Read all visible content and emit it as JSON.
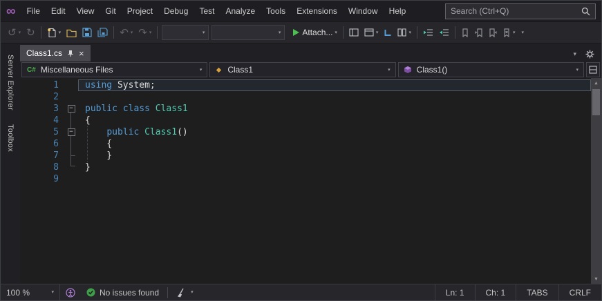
{
  "icons": {
    "logo": "∞",
    "back": "↺",
    "forward": "↻",
    "undo": "↶",
    "redo": "↷",
    "caret_down": "▾",
    "scroll_up": "▲",
    "scroll_down": "▼",
    "close": "×",
    "collapse": "−"
  },
  "menubar": {
    "menus": [
      "File",
      "Edit",
      "View",
      "Git",
      "Project",
      "Debug",
      "Test",
      "Analyze",
      "Tools",
      "Extensions",
      "Window",
      "Help"
    ],
    "search_placeholder": "Search (Ctrl+Q)"
  },
  "toolbar": {
    "attach_label": "Attach..."
  },
  "side_tabs": {
    "server_explorer": "Server Explorer",
    "toolbox": "Toolbox"
  },
  "doc": {
    "active_tab": "Class1.cs"
  },
  "navbar": {
    "project": "Miscellaneous Files",
    "type": "Class1",
    "member": "Class1()",
    "csharp_badge": "C#"
  },
  "editor": {
    "lines": [
      {
        "n": "1",
        "caret": true,
        "segs": [
          [
            "kw",
            "using"
          ],
          [
            "pl",
            " System;"
          ]
        ]
      },
      {
        "n": "2",
        "segs": []
      },
      {
        "n": "3",
        "fold": true,
        "segs": [
          [
            "kw",
            "public"
          ],
          [
            "pl",
            " "
          ],
          [
            "kw",
            "class"
          ],
          [
            "pl",
            " "
          ],
          [
            "ty",
            "Class1"
          ]
        ]
      },
      {
        "n": "4",
        "segs": [
          [
            "pl",
            "{"
          ]
        ]
      },
      {
        "n": "5",
        "fold": true,
        "segs": [
          [
            "pl",
            "    "
          ],
          [
            "kw",
            "public"
          ],
          [
            "pl",
            " "
          ],
          [
            "ty",
            "Class1"
          ],
          [
            "pl",
            "()"
          ]
        ]
      },
      {
        "n": "6",
        "segs": [
          [
            "pl",
            "    {"
          ]
        ]
      },
      {
        "n": "7",
        "segs": [
          [
            "pl",
            "    }"
          ]
        ]
      },
      {
        "n": "8",
        "segs": [
          [
            "pl",
            "}"
          ]
        ]
      },
      {
        "n": "9",
        "segs": []
      }
    ]
  },
  "statusbar": {
    "zoom": "100 %",
    "issues": "No issues found",
    "line": "Ln: 1",
    "column": "Ch: 1",
    "indent_mode": "TABS",
    "line_ending": "CRLF"
  },
  "colors": {
    "keyword": "#569cd6",
    "type_name": "#4ec9b0",
    "plain_text": "#dcdcdc",
    "editor_background": "#1e1e1e",
    "status_green": "#3f9e49",
    "accent_purple": "#b180d7",
    "attach_green": "#4cc152"
  }
}
